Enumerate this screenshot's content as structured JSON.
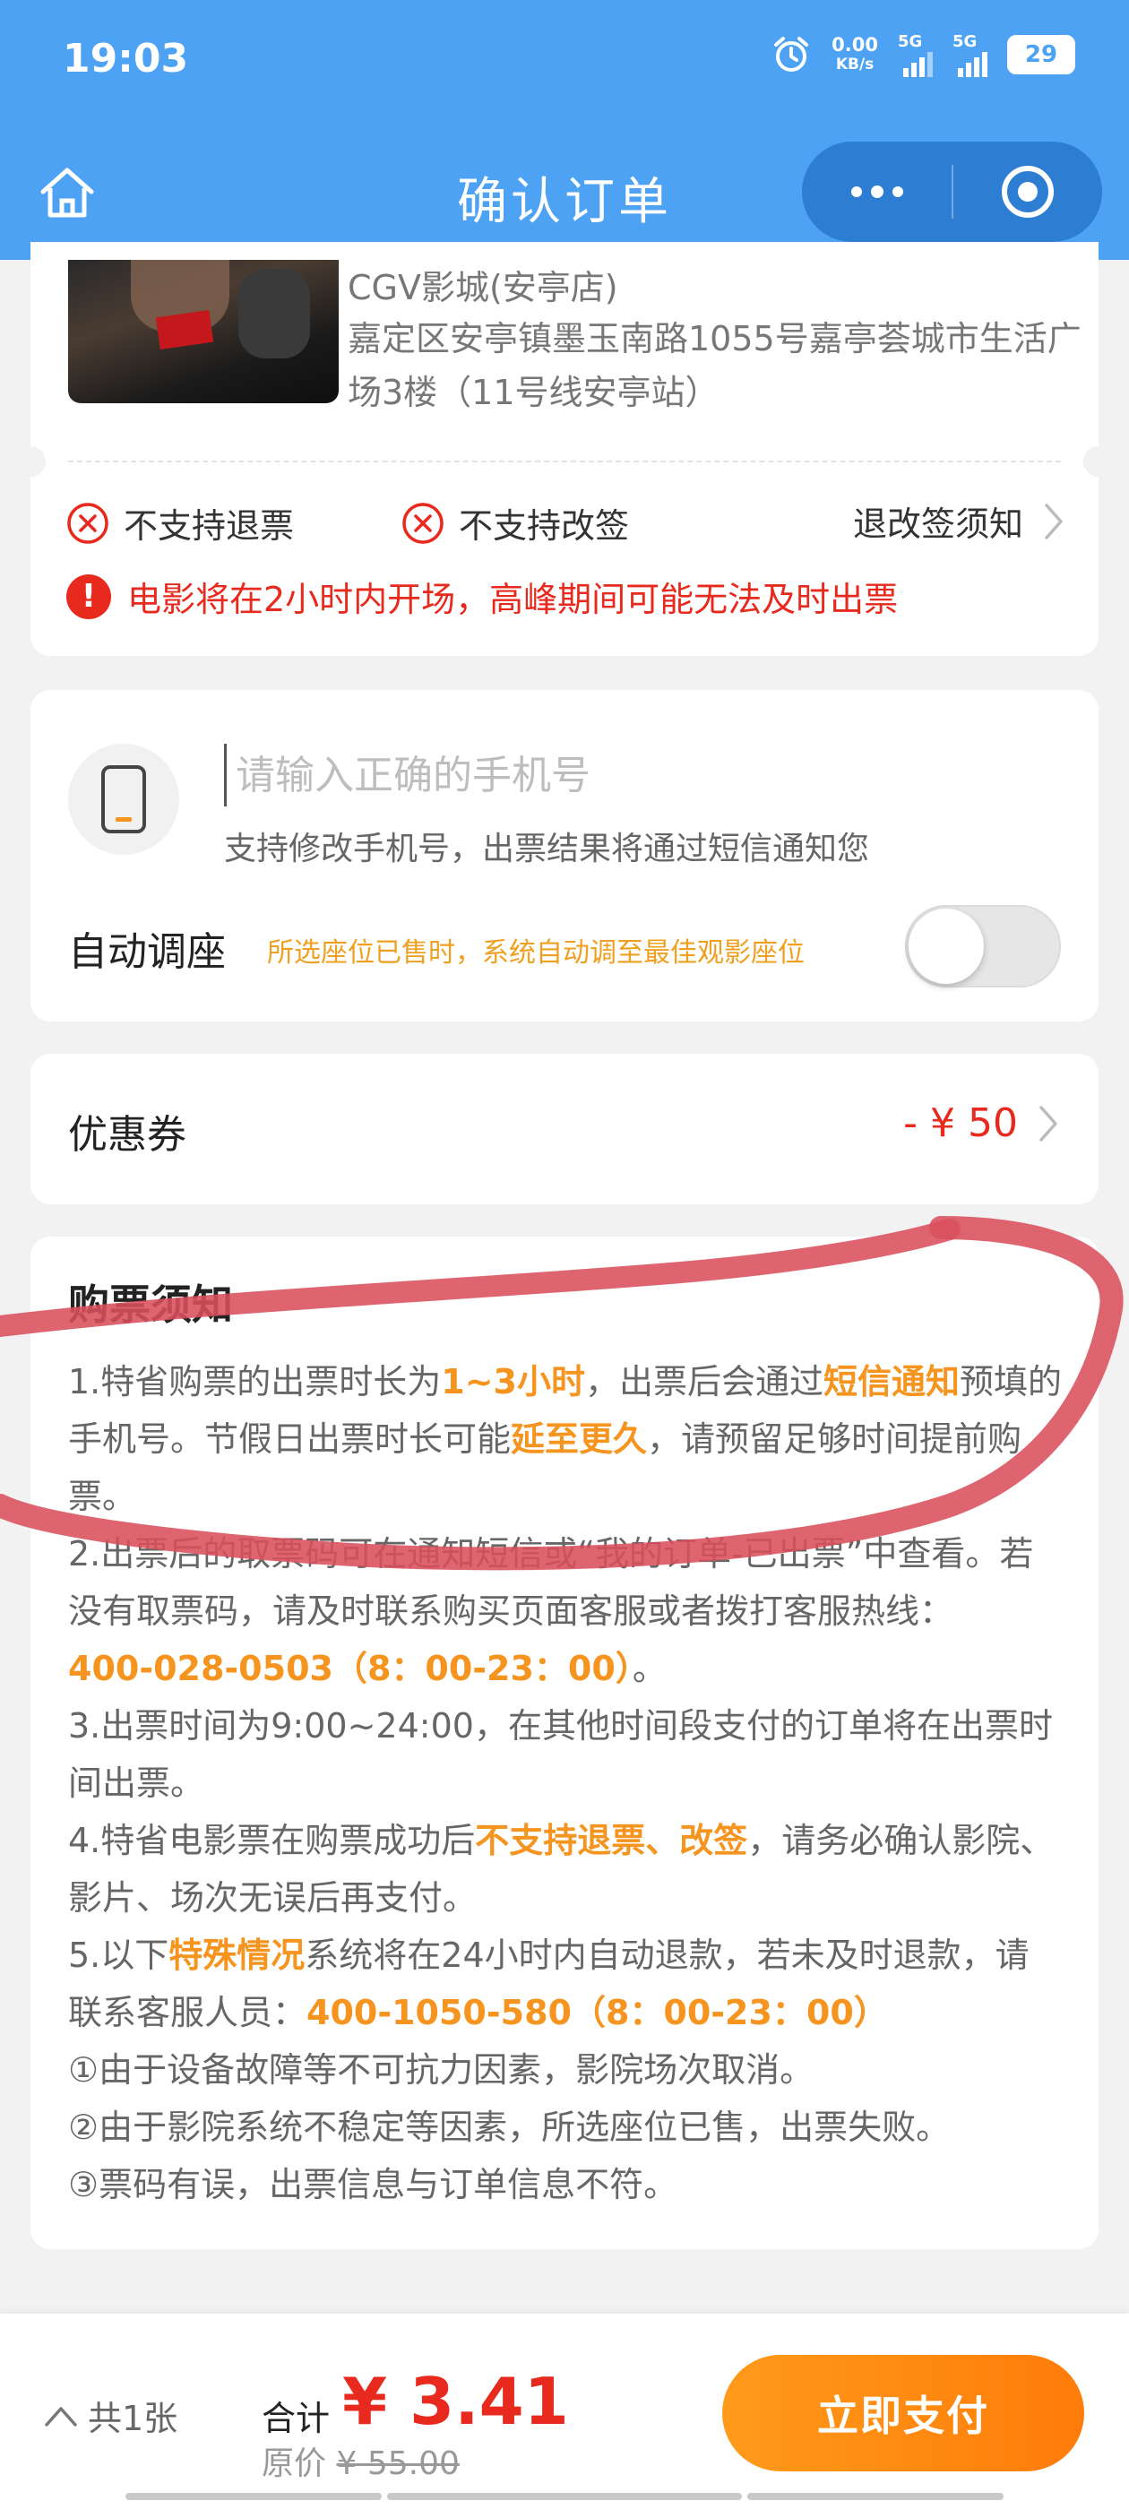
{
  "status_bar": {
    "time": "19:03",
    "net_speed_value": "0.00",
    "net_speed_unit": "KB/s",
    "sim1": "5G",
    "sim2": "5G",
    "battery": "29"
  },
  "nav": {
    "title": "确认订单"
  },
  "cinema": {
    "name": "CGV影城(安亭店)",
    "address": "嘉定区安亭镇墨玉南路1055号嘉亭荟城市生活广场3楼（11号线安亭站）"
  },
  "policy": {
    "no_refund": "不支持退票",
    "no_change": "不支持改签",
    "rules_link": "退改签须知",
    "warning": "电影将在2小时内开场，高峰期间可能无法及时出票"
  },
  "contact": {
    "phone_placeholder": "请输入正确的手机号",
    "phone_value": "",
    "phone_hint": "支持修改手机号，出票结果将通过短信通知您",
    "auto_seat_label": "自动调座",
    "auto_seat_desc": "所选座位已售时，系统自动调至最佳观影座位",
    "auto_seat_on": false
  },
  "coupon": {
    "label": "优惠券",
    "value": "- ¥ 50"
  },
  "notice": {
    "title": "购票须知",
    "l1_a": "1.特省购票的出票时长为",
    "l1_b": "1~3小时",
    "l1_c": "，出票后会通过",
    "l1_d": "短信通知",
    "l1_e": "预填的手机号。节假日出票时长可能",
    "l1_f": "延至更久",
    "l1_g": "，请预留足够时间提前购票。",
    "l2_a": "2.出票后的取票码可在通知短信或“我的订单-已出票”中查看。若没有取票码，请及时联系购买页面客服或者拨打客服热线：",
    "l2_b": "400-028-0503（8：00-23：00）",
    "l2_c": "。",
    "l3": "3.出票时间为9:00~24:00，在其他时间段支付的订单将在出票时间出票。",
    "l4_a": "4.特省电影票在购票成功后",
    "l4_b": "不支持退票、改签",
    "l4_c": "，请务必确认影院、影片、场次无误后再支付。",
    "l5_a": "5.以下",
    "l5_b": "特殊情况",
    "l5_c": "系统将在24小时内自动退款，若未及时退款，请联系客服人员：",
    "l5_d": "400-1050-580（8：00-23：00）",
    "r1": "①由于设备故障等不可抗力因素，影院场次取消。",
    "r2": "②由于影院系统不稳定等因素，所选座位已售，出票失败。",
    "r3": "③票码有误，出票信息与订单信息不符。"
  },
  "bottom": {
    "count": "共1张",
    "total_label": "合计",
    "total_value": "¥ 3.41",
    "orig_label": "原价",
    "orig_value": "¥ 55.00",
    "pay": "立即支付"
  },
  "colors": {
    "nav_blue": "#4da2f4",
    "accent_orange": "#f5941f",
    "price_red": "#e8291d",
    "annotation_red": "#d9505c"
  }
}
